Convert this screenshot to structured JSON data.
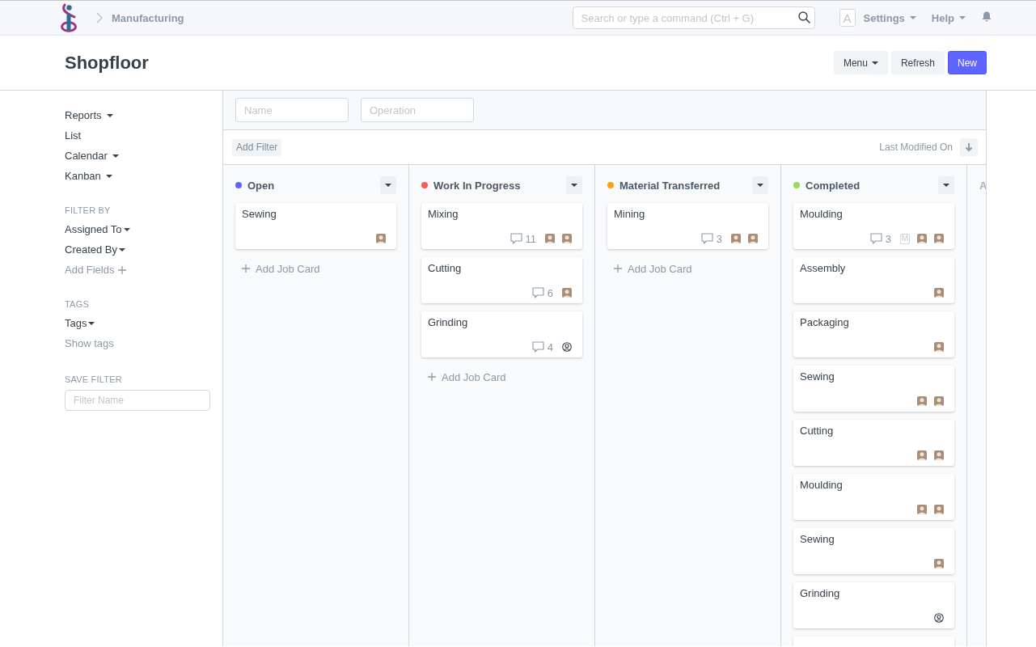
{
  "navbar": {
    "breadcrumb": "Manufacturing",
    "search": {
      "placeholder": "Search or type a command (Ctrl + G)"
    },
    "user_initial": "A",
    "menus": [
      "Settings",
      "Help"
    ]
  },
  "page_head": {
    "title": "Shopfloor",
    "buttons": [
      {
        "label": "Menu",
        "kind": "dropdown"
      },
      {
        "label": "Refresh",
        "kind": "default"
      },
      {
        "label": "New",
        "kind": "primary"
      }
    ]
  },
  "sidebar": {
    "views": [
      {
        "label": "Reports",
        "dropdown": true
      },
      {
        "label": "List",
        "dropdown": false
      },
      {
        "label": "Calendar",
        "dropdown": true
      },
      {
        "label": "Kanban",
        "dropdown": true
      }
    ],
    "sections": [
      {
        "heading": "FILTER BY",
        "items": [
          {
            "kind": "dropdown",
            "label": "Assigned To"
          },
          {
            "kind": "dropdown",
            "label": "Created By"
          },
          {
            "kind": "add",
            "label": "Add Fields"
          }
        ]
      },
      {
        "heading": "TAGS",
        "items": [
          {
            "kind": "dropdown",
            "label": "Tags"
          },
          {
            "kind": "muted",
            "label": "Show tags"
          }
        ]
      },
      {
        "heading": "SAVE FILTER",
        "items": [
          {
            "kind": "field",
            "placeholder": "Filter Name"
          }
        ]
      }
    ]
  },
  "filters": {
    "fields": [
      {
        "placeholder": "Name"
      },
      {
        "placeholder": "Operation"
      }
    ],
    "add_filter": "Add Filter",
    "sort_by": "Last Modified On"
  },
  "kanban": {
    "columns": [
      {
        "kind": "status",
        "title": "Open",
        "color": "#5e64ff",
        "cards": [
          {
            "kind": "job",
            "title": "Sewing",
            "assignees": [
              {
                "kind": "photo"
              }
            ]
          }
        ],
        "add_card": "Add Job Card"
      },
      {
        "kind": "status",
        "title": "Work In Progress",
        "color": "#ff5858",
        "cards": [
          {
            "kind": "job",
            "title": "Mixing",
            "comments": "11",
            "assignees": [
              {
                "kind": "photo"
              },
              {
                "kind": "photo"
              }
            ]
          },
          {
            "kind": "job",
            "title": "Cutting",
            "comments": "6",
            "assignees": [
              {
                "kind": "photo"
              }
            ]
          },
          {
            "kind": "job",
            "title": "Grinding",
            "comments": "4",
            "assignees": [
              {
                "kind": "placeholder"
              }
            ]
          }
        ],
        "add_card": "Add Job Card"
      },
      {
        "kind": "status",
        "title": "Material Transferred",
        "color": "#ffa00a",
        "cards": [
          {
            "kind": "job",
            "title": "Mining",
            "comments": "3",
            "assignees": [
              {
                "kind": "photo"
              },
              {
                "kind": "photo"
              }
            ]
          }
        ],
        "add_card": "Add Job Card"
      },
      {
        "kind": "status",
        "title": "Completed",
        "color": "#98d85b",
        "cards": [
          {
            "kind": "job",
            "title": "Moulding",
            "comments": "3",
            "assignees": [
              {
                "kind": "letter",
                "letter": "M"
              },
              {
                "kind": "photo"
              },
              {
                "kind": "photo"
              }
            ]
          },
          {
            "kind": "job",
            "title": "Assembly",
            "assignees": [
              {
                "kind": "photo"
              }
            ]
          },
          {
            "kind": "job",
            "title": "Packaging",
            "assignees": [
              {
                "kind": "photo"
              }
            ]
          },
          {
            "kind": "job",
            "title": "Sewing",
            "assignees": [
              {
                "kind": "photo"
              },
              {
                "kind": "photo"
              }
            ]
          },
          {
            "kind": "job",
            "title": "Cutting",
            "assignees": [
              {
                "kind": "photo"
              },
              {
                "kind": "photo"
              }
            ]
          },
          {
            "kind": "job",
            "title": "Moulding",
            "assignees": [
              {
                "kind": "photo"
              },
              {
                "kind": "photo"
              }
            ]
          },
          {
            "kind": "job",
            "title": "Sewing",
            "assignees": [
              {
                "kind": "photo"
              }
            ]
          },
          {
            "kind": "job",
            "title": "Grinding",
            "assignees": [
              {
                "kind": "placeholder"
              }
            ]
          },
          {
            "kind": "blank"
          }
        ]
      },
      {
        "kind": "add-column",
        "title": "A"
      }
    ]
  }
}
